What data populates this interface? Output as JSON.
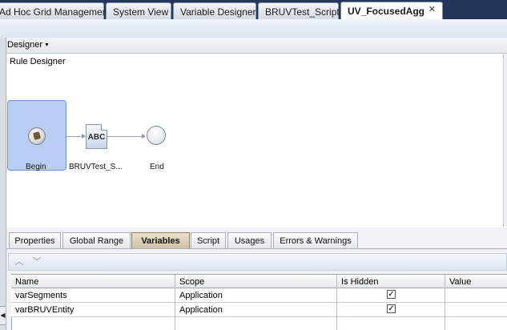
{
  "doc_tabs": [
    {
      "label": "Ad Hoc Grid Management",
      "active": false
    },
    {
      "label": "System View",
      "active": false
    },
    {
      "label": "Variable Designer",
      "active": false
    },
    {
      "label": "BRUVTest_Script",
      "active": false
    },
    {
      "label": "UV_FocusedAgg",
      "active": true
    }
  ],
  "close_glyph": "✕",
  "designer": {
    "menu_label": "Designer",
    "rule_title": "Rule Designer"
  },
  "flow": {
    "begin_label": "Begin",
    "script_icon_text": "ABC",
    "script_label": "BRUVTest_S...",
    "end_label": "End"
  },
  "prop_tabs": [
    {
      "label": "Properties",
      "active": false
    },
    {
      "label": "Global Range",
      "active": false
    },
    {
      "label": "Variables",
      "active": true
    },
    {
      "label": "Script",
      "active": false
    },
    {
      "label": "Usages",
      "active": false
    },
    {
      "label": "Errors & Warnings",
      "active": false
    }
  ],
  "toolbar": {
    "move_up_icon": "chevron-up-icon",
    "move_down_icon": "chevron-down-icon"
  },
  "variables_table": {
    "columns": [
      "Name",
      "Scope",
      "Is Hidden",
      "Value"
    ],
    "rows": [
      {
        "name": "varSegments",
        "scope": "Application",
        "is_hidden": true,
        "value": ""
      },
      {
        "name": "varBRUVEntity",
        "scope": "Application",
        "is_hidden": true,
        "value": ""
      }
    ]
  },
  "colors": {
    "tabbar_bg": "#24365a",
    "begin_highlight": "#b9cdf5",
    "active_prop_tab": "#cbbf9f"
  }
}
